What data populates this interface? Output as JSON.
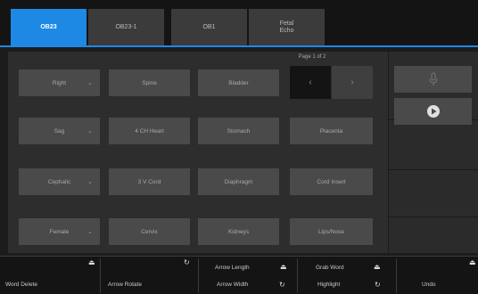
{
  "tabs": [
    {
      "label": "OB23",
      "active": true
    },
    {
      "label": "OB23-1",
      "active": false
    },
    {
      "label": "OB1",
      "active": false
    },
    {
      "label": "Fetal\nEcho",
      "active": false
    }
  ],
  "page_indicator": "Page 1 of 2",
  "grid": {
    "rows": [
      [
        "Right",
        "Spine",
        "Bladder"
      ],
      [
        "Sag",
        "4 CH Heart",
        "Stomach",
        "Placenta"
      ],
      [
        "Cephalic",
        "3 V Cord",
        "Diaphragm",
        "Cord Insert"
      ],
      [
        "Female",
        "Cervix",
        "Kidneys",
        "Lips/Nose"
      ]
    ]
  },
  "nav": {
    "prev_icon": "‹",
    "next_icon": "›"
  },
  "right": {
    "mic_icon": "mic-icon",
    "play_icon": "play-icon"
  },
  "footer": {
    "word_delete": "Word Delete",
    "arrow_rotate": "Arrow Rotate",
    "arrow_length": "Arrow Length",
    "arrow_width": "Arrow Width",
    "grab_word": "Grab Word",
    "highlight": "Highlight",
    "undo": "Undo"
  },
  "colors": {
    "accent": "#1e88e5"
  }
}
